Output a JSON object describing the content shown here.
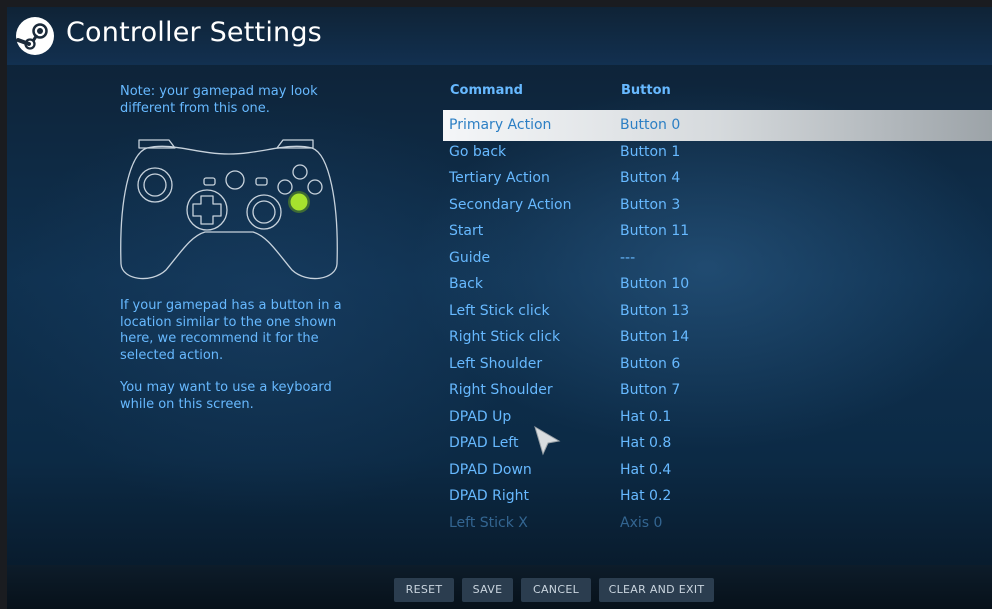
{
  "header": {
    "title": "Controller Settings"
  },
  "left": {
    "note": "Note: your gamepad may look different from this one.",
    "hint": "If your gamepad has a button in a location similar to the one shown here, we recommend it for the selected action.",
    "keyboard": "You may want to use a keyboard while on this screen."
  },
  "table": {
    "headers": {
      "command": "Command",
      "button": "Button"
    },
    "rows": [
      {
        "command": "Primary Action",
        "button": "Button 0",
        "selected": true
      },
      {
        "command": "Go back",
        "button": "Button 1"
      },
      {
        "command": "Tertiary Action",
        "button": "Button 4"
      },
      {
        "command": "Secondary Action",
        "button": "Button 3"
      },
      {
        "command": "Start",
        "button": "Button 11"
      },
      {
        "command": "Guide",
        "button": "---"
      },
      {
        "command": "Back",
        "button": "Button 10"
      },
      {
        "command": "Left Stick click",
        "button": "Button 13"
      },
      {
        "command": "Right Stick click",
        "button": "Button 14"
      },
      {
        "command": "Left Shoulder",
        "button": "Button 6"
      },
      {
        "command": "Right Shoulder",
        "button": "Button 7"
      },
      {
        "command": "DPAD Up",
        "button": "Hat 0.1"
      },
      {
        "command": "DPAD Left",
        "button": "Hat 0.8"
      },
      {
        "command": "DPAD Down",
        "button": "Hat 0.4"
      },
      {
        "command": "DPAD Right",
        "button": "Hat 0.2"
      },
      {
        "command": "Left Stick X",
        "button": "Axis 0"
      }
    ]
  },
  "footer": {
    "reset": "RESET",
    "save": "SAVE",
    "cancel": "CANCEL",
    "clear_exit": "CLEAR AND EXIT"
  },
  "colors": {
    "accent_text": "#67b9ff",
    "highlight_button": "#a6e22e"
  },
  "icons": {
    "logo": "steam-logo-icon",
    "gamepad": "gamepad-outline-icon",
    "cursor": "mouse-pointer-icon"
  }
}
